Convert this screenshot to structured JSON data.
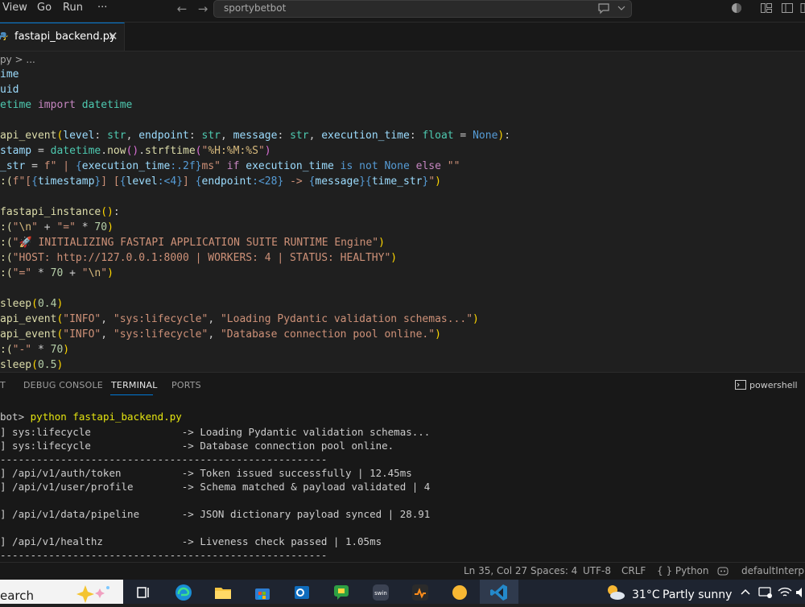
{
  "titlebar": {
    "menu": [
      "View",
      "Go",
      "Run",
      "···"
    ],
    "search_text": "sportybetbot"
  },
  "tab": {
    "label": "fastapi_backend.py",
    "close": "✕"
  },
  "breadcrumb": "py > ...",
  "code_lines": [
    [
      [
        "ime",
        "var"
      ]
    ],
    [
      [
        "uid",
        "var"
      ]
    ],
    [
      [
        "etime ",
        "ty"
      ],
      [
        "import ",
        "kw"
      ],
      [
        "datetime",
        "ty"
      ]
    ],
    [],
    [
      [
        "api_event",
        "fn"
      ],
      [
        "(",
        "br1"
      ],
      [
        "level",
        "var"
      ],
      [
        ": ",
        ""
      ],
      [
        "str",
        "ty"
      ],
      [
        ", ",
        ""
      ],
      [
        "endpoint",
        "var"
      ],
      [
        ": ",
        ""
      ],
      [
        "str",
        "ty"
      ],
      [
        ", ",
        ""
      ],
      [
        "message",
        "var"
      ],
      [
        ": ",
        ""
      ],
      [
        "str",
        "ty"
      ],
      [
        ", ",
        ""
      ],
      [
        "execution_time",
        "var"
      ],
      [
        ": ",
        ""
      ],
      [
        "float",
        "ty"
      ],
      [
        " = ",
        ""
      ],
      [
        "None",
        "kb"
      ],
      [
        ")",
        "br1"
      ],
      [
        ":",
        ""
      ]
    ],
    [
      [
        "stamp",
        "var"
      ],
      [
        " = ",
        ""
      ],
      [
        "datetime",
        "ty"
      ],
      [
        ".",
        ""
      ],
      [
        "now",
        "fn"
      ],
      [
        "()",
        "br2"
      ],
      [
        ".",
        ""
      ],
      [
        "strftime",
        "fn"
      ],
      [
        "(",
        "br2"
      ],
      [
        "\"",
        "str"
      ],
      [
        "%H:%M:%S",
        "esc"
      ],
      [
        "\"",
        "str"
      ],
      [
        ")",
        "br2"
      ]
    ],
    [
      [
        "_str",
        "var"
      ],
      [
        " = ",
        ""
      ],
      [
        "f\" | ",
        "str"
      ],
      [
        "{",
        "fmt"
      ],
      [
        "execution_time",
        "var"
      ],
      [
        ":.2f",
        "fmt"
      ],
      [
        "}",
        "fmt"
      ],
      [
        "ms\"",
        "str"
      ],
      [
        " if ",
        "kw"
      ],
      [
        "execution_time",
        "var"
      ],
      [
        " is not ",
        "kb"
      ],
      [
        "None",
        "kb"
      ],
      [
        " else ",
        "kw"
      ],
      [
        "\"\"",
        "str"
      ]
    ],
    [
      [
        ":(",
        "fn"
      ],
      [
        "f\"[",
        "str"
      ],
      [
        "{",
        "fmt"
      ],
      [
        "timestamp",
        "var"
      ],
      [
        "}",
        "fmt"
      ],
      [
        "] [",
        "str"
      ],
      [
        "{",
        "fmt"
      ],
      [
        "level",
        "var"
      ],
      [
        ":<4",
        "fmt"
      ],
      [
        "}",
        "fmt"
      ],
      [
        "] ",
        "str"
      ],
      [
        "{",
        "fmt"
      ],
      [
        "endpoint",
        "var"
      ],
      [
        ":<28",
        "fmt"
      ],
      [
        "}",
        "fmt"
      ],
      [
        " -> ",
        "str"
      ],
      [
        "{",
        "fmt"
      ],
      [
        "message",
        "var"
      ],
      [
        "}",
        "fmt"
      ],
      [
        "{",
        "fmt"
      ],
      [
        "time_str",
        "var"
      ],
      [
        "}",
        "fmt"
      ],
      [
        "\"",
        "str"
      ],
      [
        ")",
        "br1"
      ]
    ],
    [],
    [
      [
        "fastapi_instance",
        "fn"
      ],
      [
        "()",
        "br1"
      ],
      [
        ":",
        ""
      ]
    ],
    [
      [
        ":(",
        "fn"
      ],
      [
        "\"",
        "str"
      ],
      [
        "\\n",
        "esc"
      ],
      [
        "\"",
        "str"
      ],
      [
        " + ",
        ""
      ],
      [
        "\"=\"",
        "str"
      ],
      [
        " * ",
        ""
      ],
      [
        "70",
        "num"
      ],
      [
        ")",
        "br1"
      ]
    ],
    [
      [
        ":(",
        "fn"
      ],
      [
        "\"🚀 INITIALIZING FASTAPI APPLICATION SUITE RUNTIME Engine\"",
        "str"
      ],
      [
        ")",
        "br1"
      ]
    ],
    [
      [
        ":(",
        "fn"
      ],
      [
        "\"HOST: ",
        "str"
      ],
      [
        "http://127.0.0.1:8000",
        "str"
      ],
      [
        " | WORKERS: 4 | STATUS: HEALTHY\"",
        "str"
      ],
      [
        ")",
        "br1"
      ]
    ],
    [
      [
        ":(",
        "fn"
      ],
      [
        "\"=\"",
        "str"
      ],
      [
        " * ",
        ""
      ],
      [
        "70",
        "num"
      ],
      [
        " + ",
        ""
      ],
      [
        "\"",
        "str"
      ],
      [
        "\\n",
        "esc"
      ],
      [
        "\"",
        "str"
      ],
      [
        ")",
        "br1"
      ]
    ],
    [],
    [
      [
        "sleep",
        "fn"
      ],
      [
        "(",
        "br1"
      ],
      [
        "0.4",
        "num"
      ],
      [
        ")",
        "br1"
      ]
    ],
    [
      [
        "api_event",
        "fn"
      ],
      [
        "(",
        "br1"
      ],
      [
        "\"INFO\"",
        "str"
      ],
      [
        ", ",
        ""
      ],
      [
        "\"sys:lifecycle\"",
        "str"
      ],
      [
        ", ",
        ""
      ],
      [
        "\"Loading Pydantic validation schemas...\"",
        "str"
      ],
      [
        ")",
        "br1"
      ]
    ],
    [
      [
        "api_event",
        "fn"
      ],
      [
        "(",
        "br1"
      ],
      [
        "\"INFO\"",
        "str"
      ],
      [
        ", ",
        ""
      ],
      [
        "\"sys:lifecycle\"",
        "str"
      ],
      [
        ", ",
        ""
      ],
      [
        "\"Database connection pool online.\"",
        "str"
      ],
      [
        ")",
        "br1"
      ]
    ],
    [
      [
        ":(",
        "fn"
      ],
      [
        "\"-\"",
        "str"
      ],
      [
        " * ",
        ""
      ],
      [
        "70",
        "num"
      ],
      [
        ")",
        "br1"
      ]
    ],
    [
      [
        "sleep",
        "fn"
      ],
      [
        "(",
        "br1"
      ],
      [
        "0.5",
        "num"
      ],
      [
        ")",
        "br1"
      ]
    ]
  ],
  "panel": {
    "tabs": [
      "T",
      "DEBUG CONSOLE",
      "TERMINAL",
      "PORTS"
    ],
    "active_tab": "TERMINAL",
    "shell": "powershell"
  },
  "terminal": {
    "prompt": "bot> ",
    "command": "python fastapi_backend.py",
    "lines": [
      "] sys:lifecycle               -> Loading Pydantic validation schemas...",
      "] sys:lifecycle               -> Database connection pool online.",
      "------------------------------------------------------",
      "] /api/v1/auth/token          -> Token issued successfully | 12.45ms",
      "] /api/v1/user/profile        -> Schema matched & payload validated | 4",
      "",
      "] /api/v1/data/pipeline       -> JSON dictionary payload synced | 28.91",
      "",
      "] /api/v1/healthz             -> Liveness check passed | 1.05ms",
      "------------------------------------------------------"
    ]
  },
  "statusbar": {
    "position": "Ln 35, Col 27",
    "spaces": "Spaces: 4",
    "encoding": "UTF-8",
    "eol": "CRLF",
    "language": "{ } Python",
    "interpreter": "defaultInterpre"
  },
  "taskbar": {
    "search": "earch",
    "temperature": "31°C",
    "weather": "Partly sunny"
  }
}
